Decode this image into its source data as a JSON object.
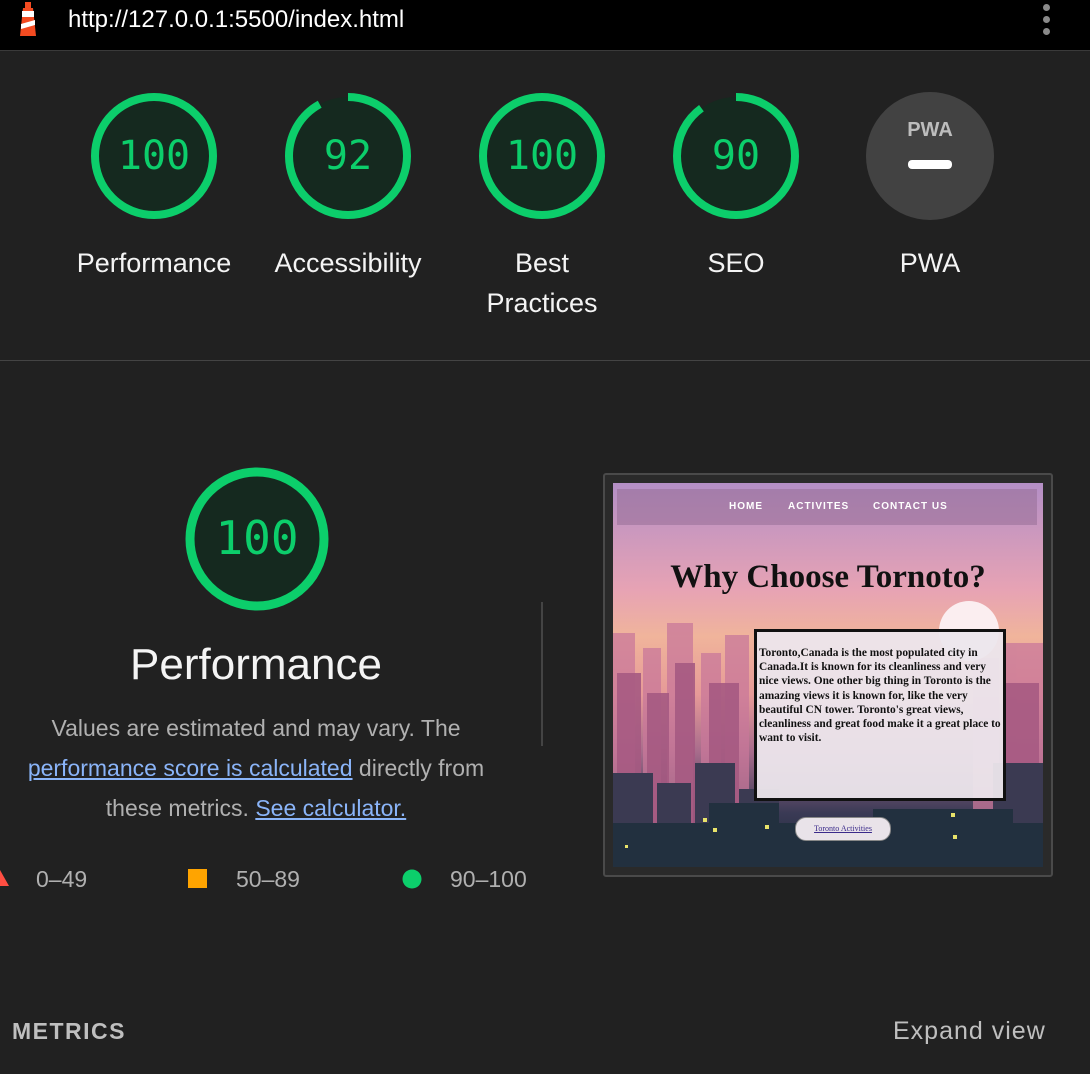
{
  "browser": {
    "url": "http://127.0.0.1:5500/index.html",
    "logo_icon": "lighthouse-icon",
    "menu_icon": "vertical-dots-icon"
  },
  "colors": {
    "pass": "#0cce6b",
    "average": "#ffa400",
    "fail": "#ff4e42",
    "pwa_gauge": "#424242"
  },
  "gauges": [
    {
      "score": "100",
      "value": 100,
      "label": "Performance"
    },
    {
      "score": "92",
      "value": 92,
      "label": "Accessibility"
    },
    {
      "score": "100",
      "value": 100,
      "label": "Best Practices"
    },
    {
      "score": "90",
      "value": 90,
      "label": "SEO"
    },
    {
      "score": "",
      "value": null,
      "label": "PWA",
      "badge": "PWA",
      "icon": "pwa-badge-icon"
    }
  ],
  "performance": {
    "score": "100",
    "value": 100,
    "title": "Performance",
    "desc_prefix": "Values are estimated and may vary. The",
    "desc_link": "performance score is calculated",
    "desc_mid": "directly from these metrics.",
    "calc_link": "See calculator."
  },
  "legend": [
    {
      "icon": "triangle-icon",
      "label": "0–49"
    },
    {
      "icon": "square-icon",
      "label": "50–89"
    },
    {
      "icon": "circle-icon",
      "label": "90–100"
    }
  ],
  "screenshot": {
    "nav": [
      "HOME",
      "ACTIVITES",
      "CONTACT US"
    ],
    "title": "Why Choose Tornoto?",
    "body": "Toronto,Canada is the most populated city in Canada.It is known for its cleanliness and very nice views. One other big thing in Toronto is the amazing views it is known for, like the very beautiful CN tower. Toronto's great views, cleanliness and great food make it a great place to want to visit.",
    "button": "Toronto Activities"
  },
  "metrics": {
    "heading": "METRICS",
    "expand": "Expand view"
  }
}
